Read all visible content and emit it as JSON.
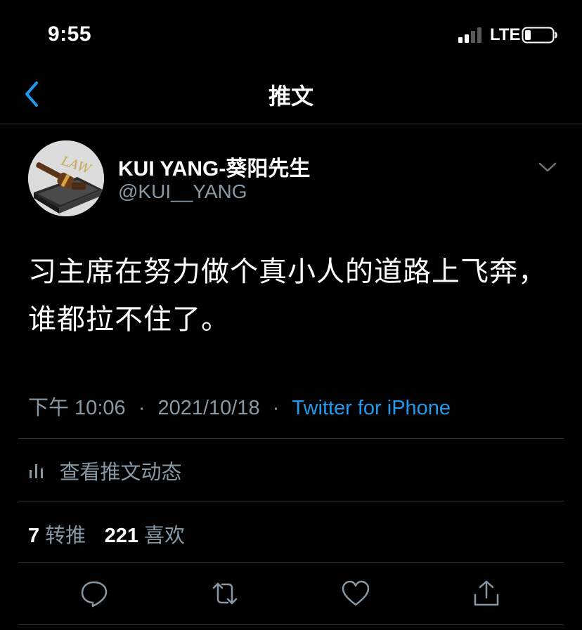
{
  "status_bar": {
    "time": "9:55",
    "network": "LTE",
    "icons": [
      "signal-icon",
      "battery-icon"
    ]
  },
  "nav": {
    "title": "推文",
    "back_icon": "chevron-left-icon"
  },
  "tweet": {
    "author": {
      "display_name": "KUI YANG-葵阳先生",
      "handle": "@KUI__YANG",
      "avatar_text": "LAW"
    },
    "text": "习主席在努力做个真小人的道路上飞奔，谁都拉不住了。",
    "time": "下午 10:06",
    "separator": "·",
    "date": "2021/10/18",
    "source": "Twitter for iPhone"
  },
  "activity": {
    "label": "查看推文动态",
    "icon": "bar-chart-icon"
  },
  "stats": {
    "retweets_count": "7",
    "retweets_label": "转推",
    "likes_count": "221",
    "likes_label": "喜欢"
  },
  "actions": [
    "reply-icon",
    "retweet-icon",
    "like-icon",
    "share-icon"
  ],
  "colors": {
    "background": "#000000",
    "accent": "#1d9bf0",
    "secondary_text": "#8899a6",
    "divider": "#2f3336"
  }
}
